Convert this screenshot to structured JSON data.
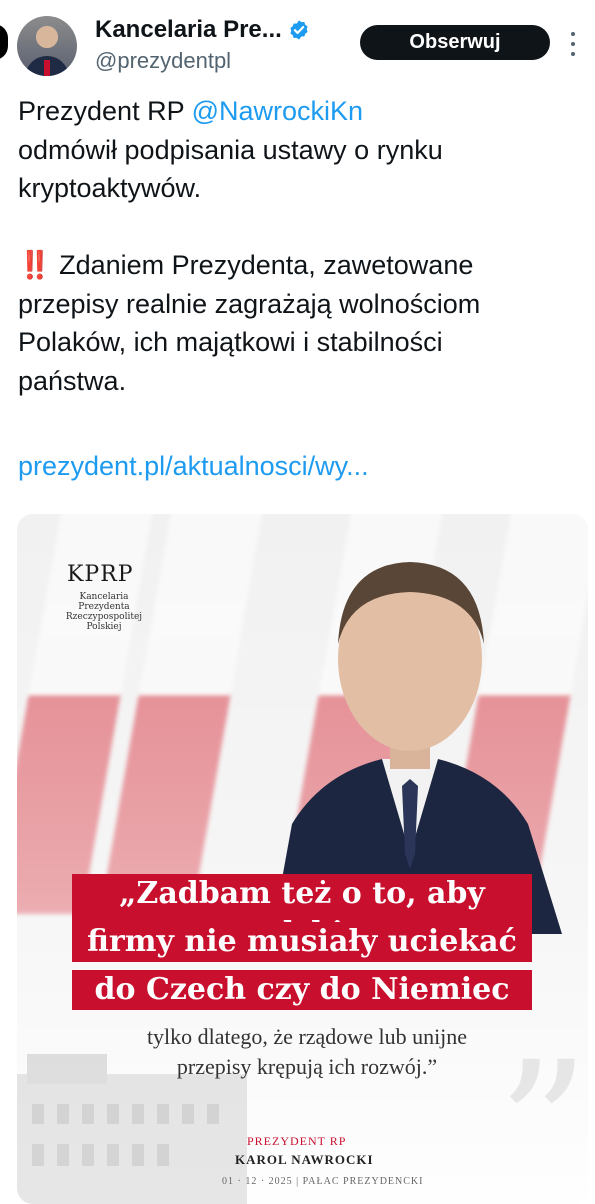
{
  "header": {
    "name": "Kancelaria Pre...",
    "handle": "@prezydentpl",
    "follow_label": "Obserwuj"
  },
  "tweet": {
    "part1": "Prezydent RP ",
    "mention": "@NawrockiKn",
    "part2": "\nodmówił podpisania ustawy o rynku\nkryptoaktywów.\n\n",
    "emoji": "‼️",
    "part3": " Zdaniem Prezydenta, zawetowane\nprzepisy realnie zagrażają wolnościom\nPolaków, ich majątkowi i stabilności\npaństwa.",
    "link": "prezydent.pl/aktualnosci/wy..."
  },
  "media": {
    "logo": "KPRP",
    "logo_sub": "Kancelaria Prezydenta\nRzeczypospolitej\nPolskiej",
    "quote_lines": [
      "„Zadbam też o to, aby polskie",
      "firmy nie musiały uciekać",
      "do Czech czy do Niemiec"
    ],
    "quote_sub": "tylko dlatego, że rządowe lub unijne\nprzepisy krępują ich rozwój.”",
    "sig_title": "PREZYDENT RP",
    "sig_name": "KAROL NAWROCKI",
    "sig_line": "01 · 12 · 2025   |   PAŁAC PREZYDENCKI"
  },
  "colors": {
    "accent_link": "#1d9bf0",
    "brand_red": "#c8102e",
    "text": "#0f1419",
    "muted": "#536471"
  }
}
